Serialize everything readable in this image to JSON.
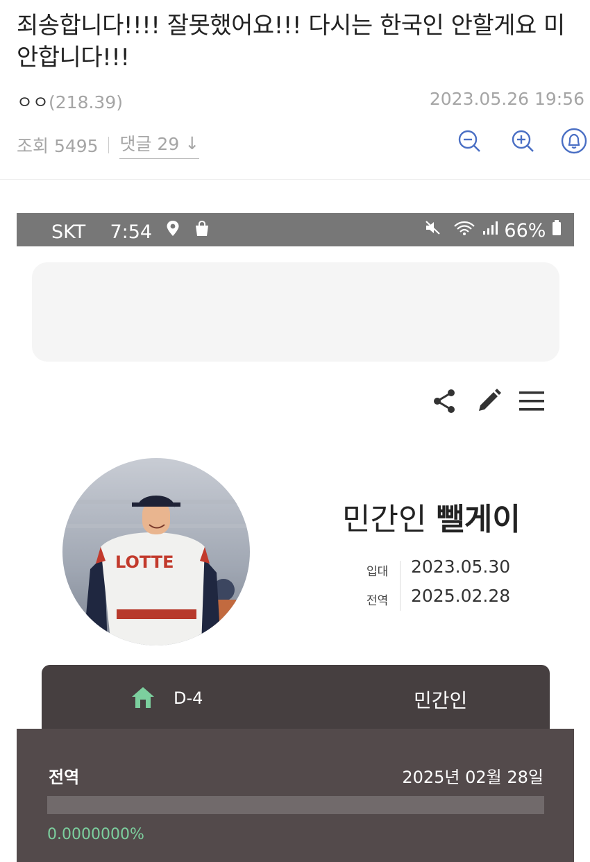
{
  "post": {
    "title": "죄송합니다!!!! 잘못했어요!!! 다시는 한국인 안할게요 미안합니다!!!",
    "author": "ㅇㅇ",
    "author_score": "(218.39)",
    "date": "2023.05.26 19:56",
    "views_label": "조회 5495",
    "comments_label": "댓글 29",
    "comments_arrow": "↓"
  },
  "toolbar": {
    "icons": [
      "zoom-out-icon",
      "zoom-in-icon",
      "bell-icon"
    ]
  },
  "statusbar": {
    "carrier": "SKT",
    "time": "7:54",
    "battery": "66%"
  },
  "profile": {
    "name_prefix": "민간인",
    "name_strong": "뺄게이",
    "enlist_label": "입대",
    "enlist_date": "2023.05.30",
    "discharge_label": "전역",
    "discharge_date": "2025.02.28",
    "photo_jersey_text": "LOTTE"
  },
  "tabs": {
    "dday": "D-4",
    "status": "민간인"
  },
  "panel": {
    "label": "전역",
    "date": "2025년 02월 28일",
    "progress_text": "0.0000000%",
    "progress_fraction": 0.0
  },
  "colors": {
    "accent_blue": "#4a6fc4",
    "tab_bg": "#463f40",
    "panel_bg": "#534a4b",
    "progress_green": "#7ccf9e"
  }
}
